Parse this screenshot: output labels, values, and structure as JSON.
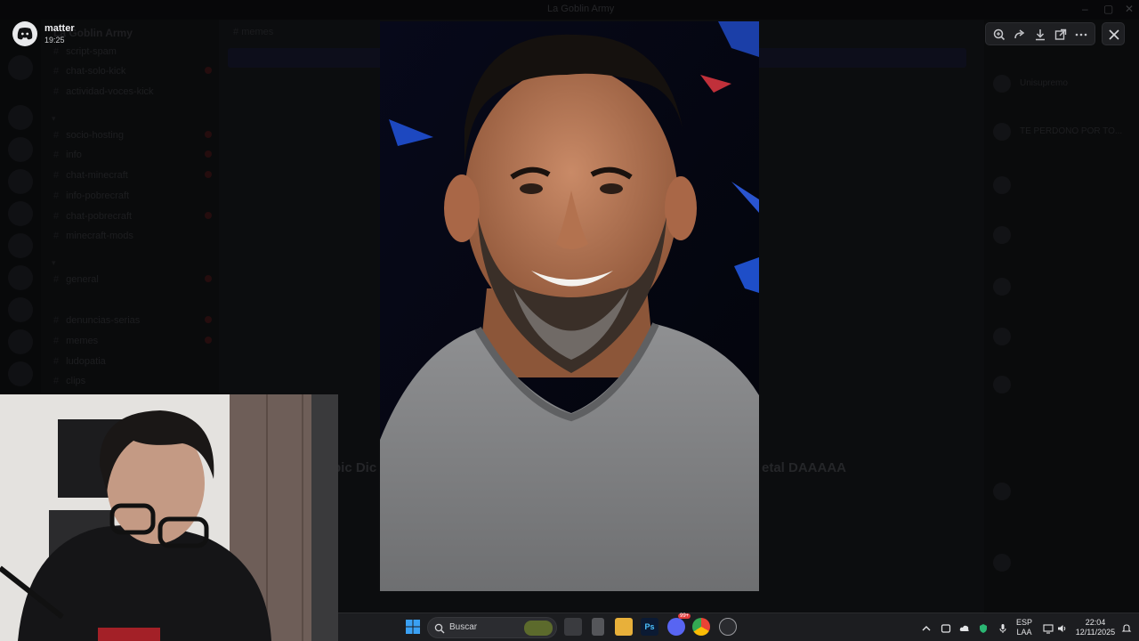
{
  "window": {
    "title": "La Goblin Army"
  },
  "background_discord": {
    "server_name": "La Goblin Army",
    "channel_header": "memes",
    "channels": [
      {
        "label": "script-spam"
      },
      {
        "label": "chat-solo-kick"
      },
      {
        "label": "actividad-voces-kick"
      },
      {
        "label": "socio-hosting"
      },
      {
        "label": "info"
      },
      {
        "label": "chat-minecraft"
      },
      {
        "label": "info-pobrecraft"
      },
      {
        "label": "chat-pobrecraft"
      },
      {
        "label": "minecraft-mods"
      },
      {
        "label": "general"
      },
      {
        "label": "denuncias-serias"
      },
      {
        "label": "memes"
      },
      {
        "label": "ludopatia"
      },
      {
        "label": "clips"
      }
    ],
    "chat_text_left": "pic Dic",
    "chat_text_right": "etal DAAAAA",
    "members": [
      {
        "name": "Unisupremo"
      },
      {
        "name": "TE PERDONO POR TO..."
      },
      {
        "name": ""
      },
      {
        "name": ""
      },
      {
        "name": ""
      },
      {
        "name": ""
      },
      {
        "name": ""
      },
      {
        "name": ""
      },
      {
        "name": ""
      }
    ]
  },
  "viewer": {
    "uploader_name": "matter",
    "uploader_time": "19:25",
    "toolbar_icons": [
      "zoom-icon",
      "forward-icon",
      "download-icon",
      "open-external-icon",
      "more-icon"
    ],
    "close_icon": "close-icon",
    "image_subject": "photo"
  },
  "taskbar": {
    "search_placeholder": "Buscar",
    "apps": [
      "windows-start-icon",
      "task-view-icon",
      "app-icon",
      "file-explorer-icon",
      "photoshop-icon",
      "discord-icon",
      "chrome-icon",
      "steam-icon"
    ],
    "photoshop_label": "Ps",
    "discord_badge": "99+",
    "language_top": "ESP",
    "language_bottom": "LAA",
    "time": "22:04",
    "date": "12/11/2025"
  }
}
